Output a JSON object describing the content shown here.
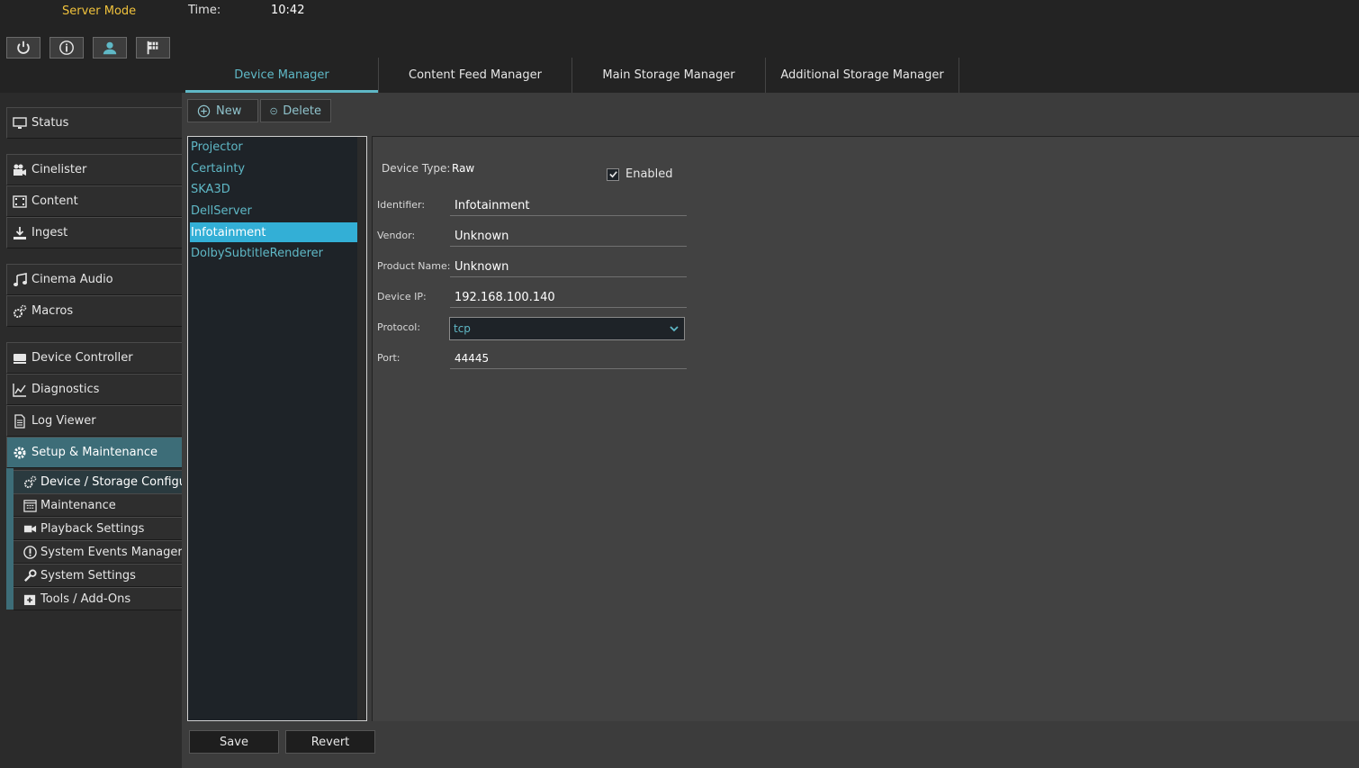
{
  "header": {
    "server_mode": "Server Mode",
    "time_label": "Time:",
    "time_value": "10:42",
    "buttons": [
      {
        "icon": "power-icon"
      },
      {
        "icon": "info-icon"
      },
      {
        "icon": "user-icon"
      },
      {
        "icon": "flag-icon"
      }
    ]
  },
  "tabs": [
    {
      "label": "Device Manager",
      "active": true
    },
    {
      "label": "Content Feed Manager"
    },
    {
      "label": "Main Storage Manager"
    },
    {
      "label": "Additional Storage Manager"
    }
  ],
  "sidebar": {
    "items": [
      {
        "label": "Status",
        "icon": "monitor-icon"
      },
      {
        "label": "Cinelister",
        "icon": "camera-icon"
      },
      {
        "label": "Content",
        "icon": "film-icon"
      },
      {
        "label": "Ingest",
        "icon": "download-icon"
      },
      {
        "label": "Cinema Audio",
        "icon": "music-icon"
      },
      {
        "label": "Macros",
        "icon": "gears-icon"
      },
      {
        "label": "Device Controller",
        "icon": "device-icon"
      },
      {
        "label": "Diagnostics",
        "icon": "chart-icon"
      },
      {
        "label": "Log Viewer",
        "icon": "document-icon"
      },
      {
        "label": "Setup & Maintenance",
        "icon": "gear-icon",
        "active": true
      }
    ],
    "sub_items": [
      {
        "label": "Device / Storage Configu…",
        "icon": "gears-icon",
        "active": true
      },
      {
        "label": "Maintenance",
        "icon": "calendar-icon"
      },
      {
        "label": "Playback Settings",
        "icon": "video-icon"
      },
      {
        "label": "System Events Manager",
        "icon": "alert-icon"
      },
      {
        "label": "System Settings",
        "icon": "wrench-icon"
      },
      {
        "label": "Tools / Add-Ons",
        "icon": "plus-box-icon"
      }
    ]
  },
  "toolbar": {
    "new_label": "New",
    "delete_label": "Delete"
  },
  "devices": [
    "Projector",
    "Certainty",
    "SKA3D",
    "DellServer",
    "Infotainment",
    "DolbySubtitleRenderer"
  ],
  "selected_device": "Infotainment",
  "detail": {
    "device_type_label": "Device Type:",
    "device_type_value": "Raw",
    "enabled_label": "Enabled",
    "enabled": true,
    "identifier_label": "Identifier:",
    "identifier_value": "Infotainment",
    "vendor_label": "Vendor:",
    "vendor_value": "Unknown",
    "product_label": "Product Name:",
    "product_value": "Unknown",
    "ip_label": "Device IP:",
    "ip_value": "192.168.100.140",
    "protocol_label": "Protocol:",
    "protocol_value": "tcp",
    "port_label": "Port:",
    "port_value": "44445"
  },
  "footer": {
    "save_label": "Save",
    "revert_label": "Revert"
  },
  "colors": {
    "accent": "#5fb8c6",
    "server_mode": "#f0c23c",
    "selection": "#33afd6",
    "active_sidebar": "#3d6d78"
  }
}
